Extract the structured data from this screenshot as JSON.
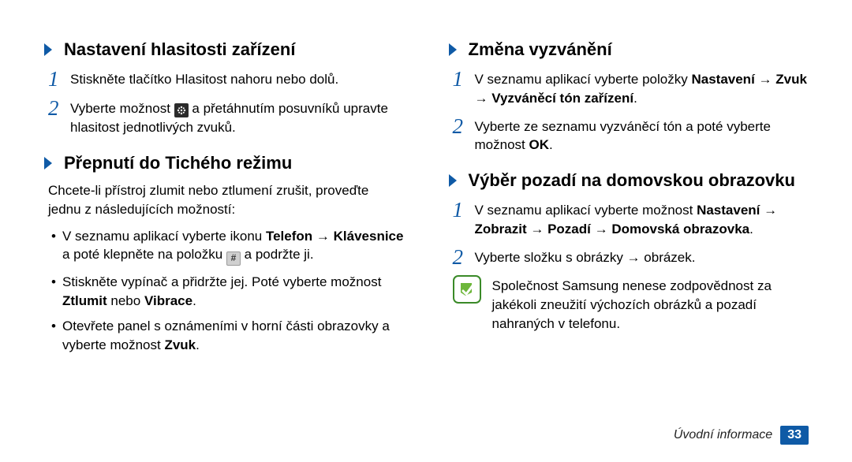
{
  "left": {
    "section1": {
      "heading": "Nastavení hlasitosti zařízení",
      "step1": "Stiskněte tlačítko Hlasitost nahoru nebo dolů.",
      "step2_a": "Vyberte možnost ",
      "step2_b": " a přetáhnutím posuvníků upravte hlasitost jednotlivých zvuků."
    },
    "section2": {
      "heading": "Přepnutí do Tichého režimu",
      "intro": "Chcete-li přístroj zlumit nebo ztlumení zrušit, proveďte jednu z následujících možností:",
      "b1_a": "V seznamu aplikací vyberte ikonu ",
      "b1_bold1": "Telefon",
      "b1_arrow": " → ",
      "b1_bold2": "Klávesnice",
      "b1_b": " a poté klepněte na položku ",
      "b1_c": " a podržte ji.",
      "b2_a": "Stiskněte vypínač a přidržte jej. Poté vyberte možnost ",
      "b2_bold1": "Ztlumit",
      "b2_mid": " nebo ",
      "b2_bold2": "Vibrace",
      "b2_end": ".",
      "b3_a": "Otevřete panel s oznámeními v horní části obrazovky a vyberte možnost ",
      "b3_bold": "Zvuk",
      "b3_end": "."
    }
  },
  "right": {
    "section1": {
      "heading": "Změna vyzvánění",
      "s1_a": "V seznamu aplikací vyberte položky ",
      "s1_bold1": "Nastavení",
      "arrow": " → ",
      "s1_bold2": "Zvuk",
      "s1_bold3": "Vyzváněcí tón zařízení",
      "s1_end": ".",
      "s2_a": "Vyberte ze seznamu vyzváněcí tón a poté vyberte možnost ",
      "s2_bold": "OK",
      "s2_end": "."
    },
    "section2": {
      "heading": "Výběr pozadí na domovskou obrazovku",
      "s1_a": "V seznamu aplikací vyberte možnost ",
      "s1_bold1": "Nastavení",
      "arrow": " → ",
      "s1_bold2": "Zobrazit",
      "s1_bold3": "Pozadí",
      "s1_bold4": "Domovská obrazovka",
      "s1_end": ".",
      "s2": "Vyberte složku s obrázky → obrázek.",
      "note": "Společnost Samsung nenese zodpovědnost za jakékoli zneužití výchozích obrázků a pozadí nahraných v telefonu."
    }
  },
  "icons": {
    "hash": "#"
  },
  "footer": {
    "label": "Úvodní informace",
    "page": "33"
  }
}
